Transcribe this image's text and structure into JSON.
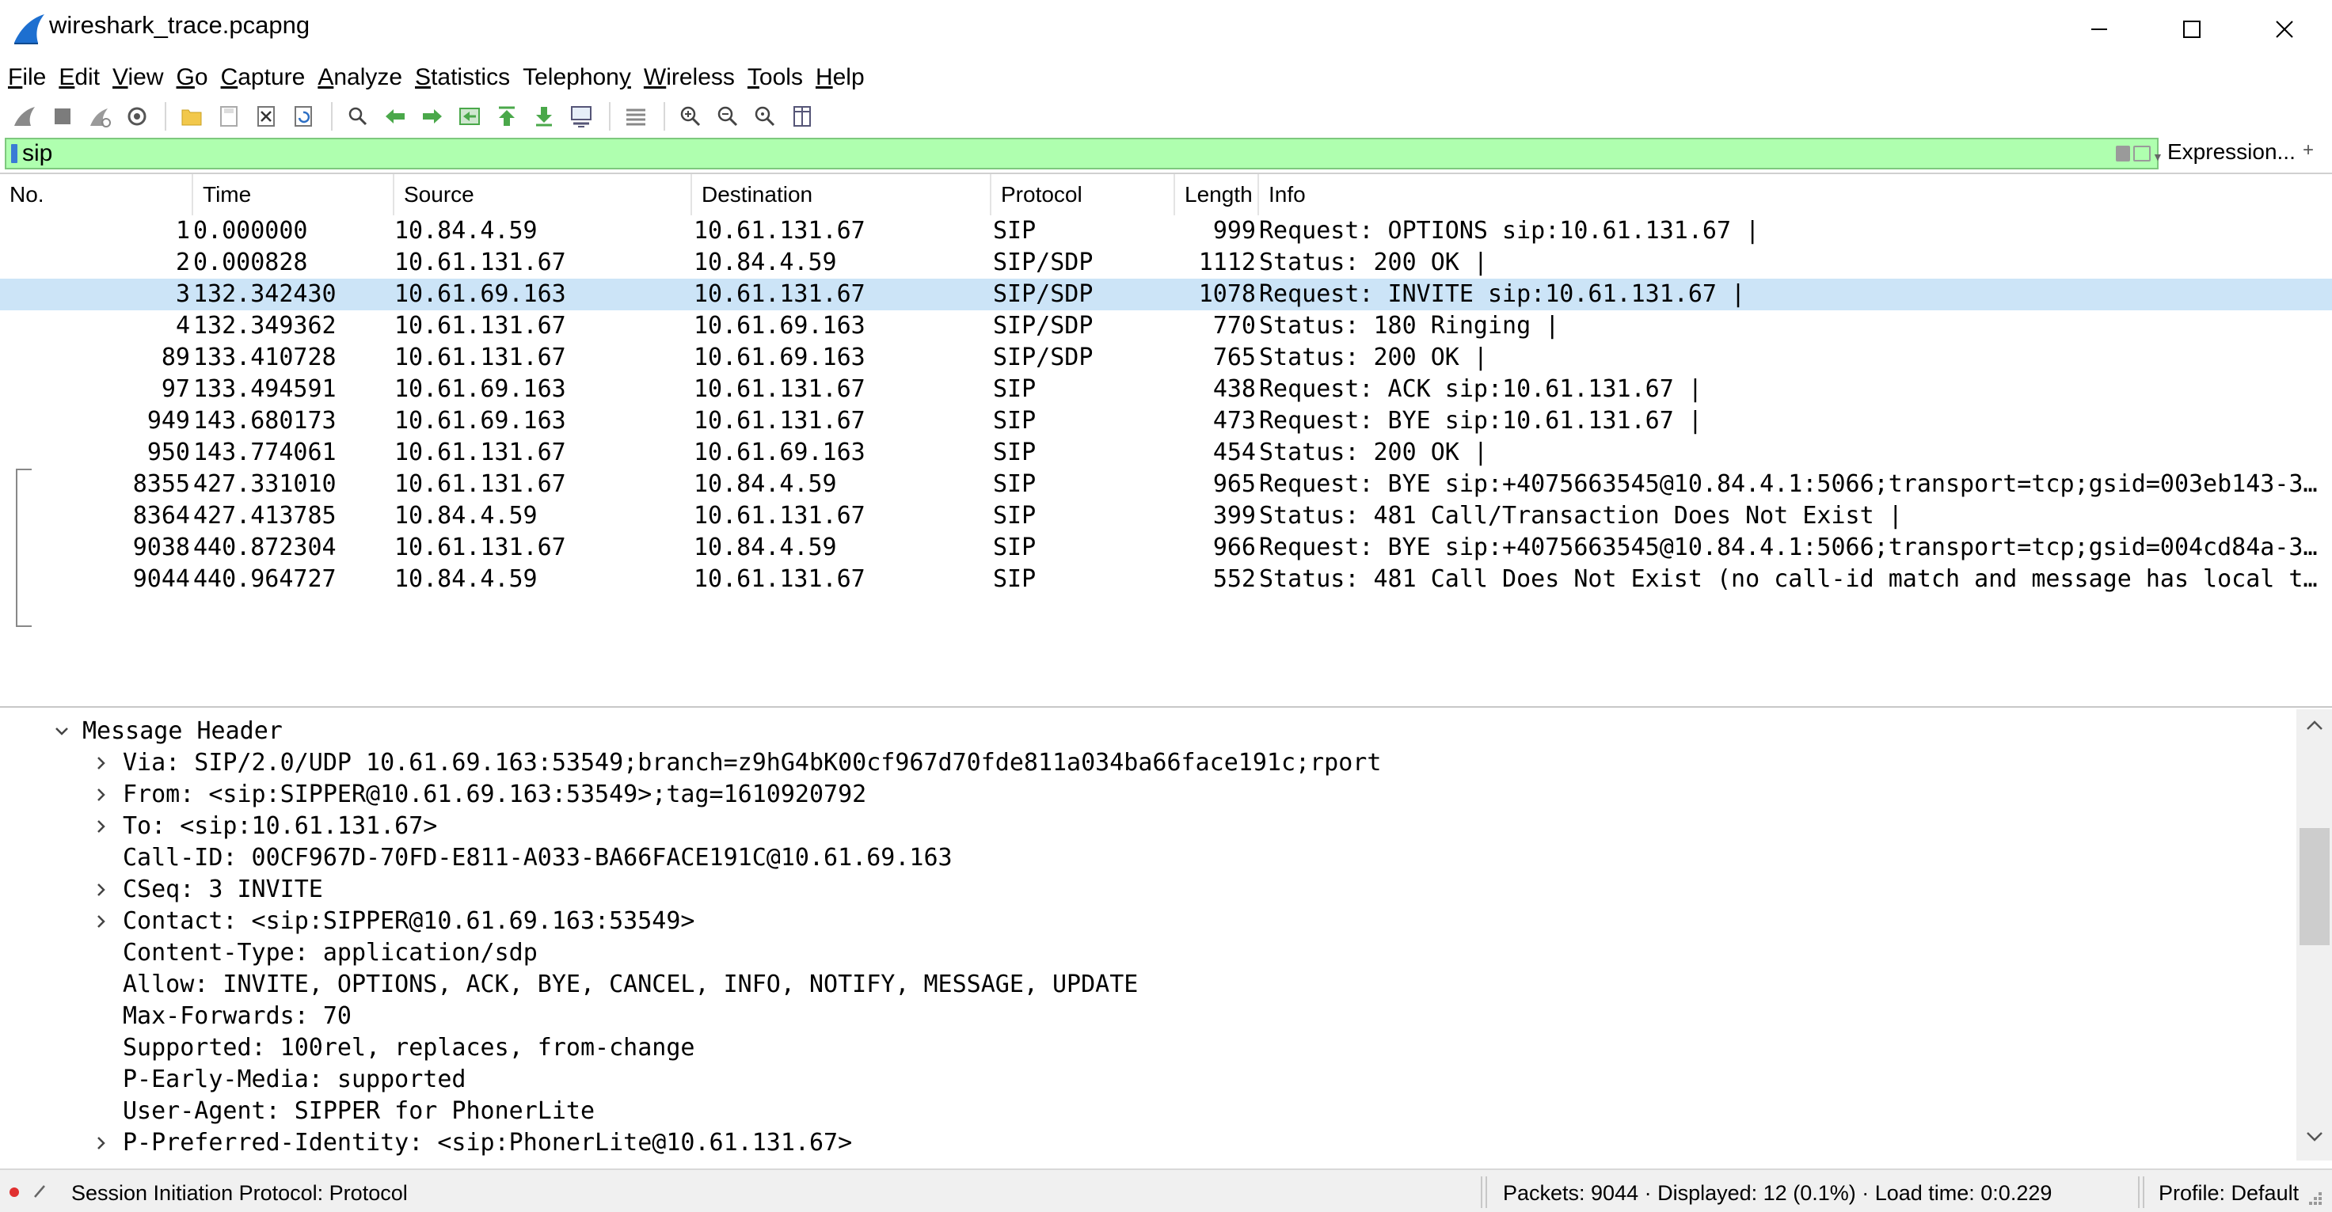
{
  "window": {
    "title": "wireshark_trace.pcapng",
    "icon": "wireshark-fin-icon"
  },
  "menu": [
    "File",
    "Edit",
    "View",
    "Go",
    "Capture",
    "Analyze",
    "Statistics",
    "Telephony",
    "Wireless",
    "Tools",
    "Help"
  ],
  "menu_accel": [
    "F",
    "E",
    "V",
    "G",
    "C",
    "A",
    "S",
    "y",
    "W",
    "T",
    "H"
  ],
  "toolbar": {
    "icons": [
      "shark-fin-start-icon",
      "stop-capture-icon",
      "restart-capture-icon",
      "capture-options-icon",
      "separator",
      "open-file-icon",
      "save-file-icon",
      "close-file-icon",
      "reload-file-icon",
      "separator",
      "find-packet-icon",
      "go-back-icon",
      "go-forward-icon",
      "go-to-packet-icon",
      "go-first-icon",
      "go-last-icon",
      "autoscroll-icon",
      "separator",
      "colorize-icon",
      "separator",
      "zoom-in-icon",
      "zoom-out-icon",
      "zoom-normal-icon",
      "resize-columns-icon"
    ]
  },
  "filter": {
    "value": "sip",
    "expression_label": "Expression...",
    "plus_label": "+"
  },
  "packet_list": {
    "columns": [
      "No.",
      "Time",
      "Source",
      "Destination",
      "Protocol",
      "Length",
      "Info"
    ],
    "rows": [
      {
        "no": "1",
        "time": "0.000000",
        "src": "10.84.4.59",
        "dst": "10.61.131.67",
        "proto": "SIP",
        "len": "999",
        "info": "Request: OPTIONS sip:10.61.131.67 |"
      },
      {
        "no": "2",
        "time": "0.000828",
        "src": "10.61.131.67",
        "dst": "10.84.4.59",
        "proto": "SIP/SDP",
        "len": "1112",
        "info": "Status: 200 OK |"
      },
      {
        "no": "3",
        "time": "132.342430",
        "src": "10.61.69.163",
        "dst": "10.61.131.67",
        "proto": "SIP/SDP",
        "len": "1078",
        "info": "Request: INVITE sip:10.61.131.67 |"
      },
      {
        "no": "4",
        "time": "132.349362",
        "src": "10.61.131.67",
        "dst": "10.61.69.163",
        "proto": "SIP/SDP",
        "len": "770",
        "info": "Status: 180 Ringing |"
      },
      {
        "no": "89",
        "time": "133.410728",
        "src": "10.61.131.67",
        "dst": "10.61.69.163",
        "proto": "SIP/SDP",
        "len": "765",
        "info": "Status: 200 OK |"
      },
      {
        "no": "97",
        "time": "133.494591",
        "src": "10.61.69.163",
        "dst": "10.61.131.67",
        "proto": "SIP",
        "len": "438",
        "info": "Request: ACK sip:10.61.131.67 |"
      },
      {
        "no": "949",
        "time": "143.680173",
        "src": "10.61.69.163",
        "dst": "10.61.131.67",
        "proto": "SIP",
        "len": "473",
        "info": "Request: BYE sip:10.61.131.67 |"
      },
      {
        "no": "950",
        "time": "143.774061",
        "src": "10.61.131.67",
        "dst": "10.61.69.163",
        "proto": "SIP",
        "len": "454",
        "info": "Status: 200 OK |"
      },
      {
        "no": "8355",
        "time": "427.331010",
        "src": "10.61.131.67",
        "dst": "10.84.4.59",
        "proto": "SIP",
        "len": "965",
        "info": "Request: BYE sip:+4075663545@10.84.4.1:5066;transport=tcp;gsid=003eb143-3…"
      },
      {
        "no": "8364",
        "time": "427.413785",
        "src": "10.84.4.59",
        "dst": "10.61.131.67",
        "proto": "SIP",
        "len": "399",
        "info": "Status: 481 Call/Transaction Does Not Exist |"
      },
      {
        "no": "9038",
        "time": "440.872304",
        "src": "10.61.131.67",
        "dst": "10.84.4.59",
        "proto": "SIP",
        "len": "966",
        "info": "Request: BYE sip:+4075663545@10.84.4.1:5066;transport=tcp;gsid=004cd84a-3…"
      },
      {
        "no": "9044",
        "time": "440.964727",
        "src": "10.84.4.59",
        "dst": "10.61.131.67",
        "proto": "SIP",
        "len": "552",
        "info": "Status: 481 Call Does Not Exist (no call-id match and message has local t…"
      }
    ],
    "selected_index": 2
  },
  "details": {
    "rows": [
      {
        "indent": 0,
        "expander": "expanded",
        "text": "Message Header"
      },
      {
        "indent": 1,
        "expander": "collapsed",
        "text": "Via: SIP/2.0/UDP 10.61.69.163:53549;branch=z9hG4bK00cf967d70fde811a034ba66face191c;rport"
      },
      {
        "indent": 1,
        "expander": "collapsed",
        "text": "From: <sip:SIPPER@10.61.69.163:53549>;tag=1610920792"
      },
      {
        "indent": 1,
        "expander": "collapsed",
        "text": "To: <sip:10.61.131.67>"
      },
      {
        "indent": 1,
        "expander": "none",
        "text": "Call-ID: 00CF967D-70FD-E811-A033-BA66FACE191C@10.61.69.163"
      },
      {
        "indent": 1,
        "expander": "collapsed",
        "text": "CSeq: 3 INVITE"
      },
      {
        "indent": 1,
        "expander": "collapsed",
        "text": "Contact: <sip:SIPPER@10.61.69.163:53549>"
      },
      {
        "indent": 1,
        "expander": "none",
        "text": "Content-Type: application/sdp"
      },
      {
        "indent": 1,
        "expander": "none",
        "text": "Allow: INVITE, OPTIONS, ACK, BYE, CANCEL, INFO, NOTIFY, MESSAGE, UPDATE"
      },
      {
        "indent": 1,
        "expander": "none",
        "text": "Max-Forwards: 70"
      },
      {
        "indent": 1,
        "expander": "none",
        "text": "Supported: 100rel, replaces, from-change"
      },
      {
        "indent": 1,
        "expander": "none",
        "text": "P-Early-Media: supported"
      },
      {
        "indent": 1,
        "expander": "none",
        "text": "User-Agent: SIPPER for PhonerLite"
      },
      {
        "indent": 1,
        "expander": "collapsed",
        "text": "P-Preferred-Identity: <sip:PhonerLite@10.61.131.67>"
      }
    ]
  },
  "status": {
    "text": "Session Initiation Protocol: Protocol",
    "packets": "Packets: 9044 · Displayed: 12 (0.1%) · Load time: 0:0.229",
    "profile": "Profile: Default"
  },
  "colors": {
    "filter_valid": "#afffaf",
    "selected_row": "#cce4f7"
  }
}
